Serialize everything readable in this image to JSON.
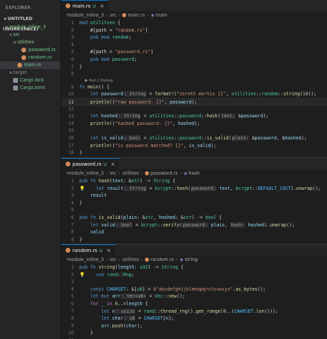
{
  "sidebar": {
    "title": "EXPLORER",
    "workspace": "UNTITLED (WORKSPACE)",
    "items": [
      {
        "label": "module_inline_3",
        "depth": 1,
        "chevron": "v",
        "kind": "folder",
        "color": "#89d185"
      },
      {
        "label": "src",
        "depth": 2,
        "chevron": "v",
        "kind": "folder",
        "color": "#89d185"
      },
      {
        "label": "utilities",
        "depth": 3,
        "chevron": "v",
        "kind": "folder",
        "color": "#89d185"
      },
      {
        "label": "password.rs",
        "depth": 4,
        "chevron": "",
        "kind": "rust",
        "color": "#73c991"
      },
      {
        "label": "random.rs",
        "depth": 4,
        "chevron": "",
        "kind": "rust",
        "color": "#73c991"
      },
      {
        "label": "main.rs",
        "depth": 3,
        "chevron": "",
        "kind": "rust",
        "color": "#73c991",
        "selected": true
      },
      {
        "label": "target",
        "depth": 2,
        "chevron": ">",
        "kind": "folder",
        "color": "#8c8c8c"
      },
      {
        "label": "Cargo.lock",
        "depth": 2,
        "chevron": "",
        "kind": "lock",
        "color": "#73c991"
      },
      {
        "label": "Cargo.toml",
        "depth": 2,
        "chevron": "",
        "kind": "toml",
        "color": "#73c991"
      }
    ]
  },
  "editors": [
    {
      "tab": {
        "label": "main.rs",
        "status": "U",
        "close": "×"
      },
      "breadcrumb": [
        "module_inline_3",
        "src",
        "main.rs",
        "main"
      ],
      "codelens": "▶ Run | Debug",
      "lines": [
        {
          "n": "1",
          "html": "<span class='k'>mod</span> <span class='t'>utilities</span> <span class='p'>{</span>"
        },
        {
          "n": "2",
          "html": "    <span class='p'>#[path = </span><span class='s'>\"random.rs\"</span><span class='p'>]</span>"
        },
        {
          "n": "3",
          "html": "    <span class='k'>pub</span> <span class='k'>mod</span> <span class='t'>random</span><span class='p'>;</span>"
        },
        {
          "n": "4",
          "html": ""
        },
        {
          "n": "5",
          "html": "    <span class='p'>#[path = </span><span class='s'>\"password.rs\"</span><span class='p'>]</span>"
        },
        {
          "n": "6",
          "html": "    <span class='k'>pub</span> <span class='k'>mod</span> <span class='t'>password</span><span class='p'>;</span>"
        },
        {
          "n": "7",
          "html": "<span class='p'>}</span>"
        },
        {
          "n": "8",
          "html": "",
          "lens": true
        },
        {
          "n": "9",
          "html": "<span class='k'>fn</span> <span class='f'>main</span><span class='p'>() {</span>"
        },
        {
          "n": "10",
          "html": "    <span class='k'>let</span> <span class='v'>password</span><span class='hint'>: String</span> <span class='p'>=</span> <span class='m'>format!</span><span class='p'>(</span><span class='s'>\"zereth mortis {}\"</span><span class='p'>, </span><span class='t'>utilities</span><span class='p'>::</span><span class='t'>random</span><span class='p'>::</span><span class='f'>string</span><span class='p'>(</span><span class='n'>10</span><span class='p'>));</span>"
        },
        {
          "n": "11",
          "html": "    <span class='m'>println!</span><span class='p'>(</span><span class='s'>\"raw password: {}\"</span><span class='p'>, </span><span class='v'>password</span><span class='p'>);</span>",
          "cur": true
        },
        {
          "n": "12",
          "html": ""
        },
        {
          "n": "13",
          "html": "    <span class='k'>let</span> <span class='v'>hashed</span><span class='hint'>: String</span> <span class='p'>=</span> <span class='t'>utilities</span><span class='p'>::</span><span class='t'>password</span><span class='p'>::</span><span class='f'>hash</span><span class='p'>(</span><span class='hint'>text:</span> <span class='p'>&amp;</span><span class='v'>password</span><span class='p'>);</span>"
        },
        {
          "n": "14",
          "html": "    <span class='m'>println!</span><span class='p'>(</span><span class='s'>\"hashed password: {}\"</span><span class='p'>, </span><span class='v'>hashed</span><span class='p'>);</span>"
        },
        {
          "n": "15",
          "html": ""
        },
        {
          "n": "16",
          "html": "    <span class='k'>let</span> <span class='v'>is_valid</span><span class='hint'>: bool</span> <span class='p'>=</span> <span class='t'>utilities</span><span class='p'>::</span><span class='t'>password</span><span class='p'>::</span><span class='f'>is_valid</span><span class='p'>(</span><span class='hint'>plain:</span> <span class='p'>&amp;</span><span class='v'>password</span><span class='p'>, &amp;</span><span class='v'>hashed</span><span class='p'>);</span>"
        },
        {
          "n": "17",
          "html": "    <span class='m'>println!</span><span class='p'>(</span><span class='s'>\"is password matched? {}\"</span><span class='p'>, </span><span class='v'>is_valid</span><span class='p'>);</span>"
        },
        {
          "n": "18",
          "html": "<span class='p'>}</span>"
        },
        {
          "n": "19",
          "html": ""
        }
      ]
    },
    {
      "tab": {
        "label": "password.rs",
        "status": "U",
        "close": "×"
      },
      "breadcrumb": [
        "module_inline_3",
        "src",
        "utilities",
        "password.rs",
        "hash"
      ],
      "lines": [
        {
          "n": "1",
          "html": "<span class='k'>pub</span> <span class='k'>fn</span> <span class='f'>hash</span><span class='p'>(</span><span class='v'>text</span><span class='p'>: &amp;</span><span class='t'>str</span><span class='p'>) -&gt; </span><span class='t'>String</span> <span class='p'>{</span>"
        },
        {
          "n": "2",
          "html": "    <span class='k'>let</span> <span class='v'>result</span><span class='hint'>: String</span> <span class='p'>=</span> <span class='t'>bcrypt</span><span class='p'>::</span><span class='f'>hash</span><span class='p'>(</span><span class='hint'>password:</span> <span class='v'>text</span><span class='p'>, </span><span class='t'>bcrypt</span><span class='p'>::</span><span class='c'>DEFAULT_COST</span><span class='p'>).</span><span class='f'>unwrap</span><span class='p'>();</span>",
          "bulb": true
        },
        {
          "n": "3",
          "html": "    <span class='v'>result</span>"
        },
        {
          "n": "4",
          "html": "<span class='p'>}</span>"
        },
        {
          "n": "5",
          "html": ""
        },
        {
          "n": "6",
          "html": "<span class='k'>pub</span> <span class='k'>fn</span> <span class='f'>is_valid</span><span class='p'>(</span><span class='v'>plain</span><span class='p'>: &amp;</span><span class='t'>str</span><span class='p'>, </span><span class='v'>hashed</span><span class='p'>: &amp;</span><span class='t'>str</span><span class='p'>) -&gt; </span><span class='t'>bool</span> <span class='p'>{</span>"
        },
        {
          "n": "7",
          "html": "    <span class='k'>let</span> <span class='v'>valid</span><span class='hint'>: bool</span> <span class='p'>=</span> <span class='t'>bcrypt</span><span class='p'>::</span><span class='f'>verify</span><span class='p'>(</span><span class='hint'>password:</span> <span class='v'>plain</span><span class='p'>, </span><span class='hint'>hash:</span> <span class='v'>hashed</span><span class='p'>).</span><span class='f'>unwrap</span><span class='p'>();</span>"
        },
        {
          "n": "8",
          "html": "    <span class='v'>valid</span>"
        },
        {
          "n": "9",
          "html": "<span class='p'>}</span>"
        },
        {
          "n": "10",
          "html": ""
        }
      ]
    },
    {
      "tab": {
        "label": "random.rs",
        "status": "U",
        "close": "×"
      },
      "breadcrumb": [
        "module_inline_3",
        "src",
        "utilities",
        "random.rs",
        "string"
      ],
      "lines": [
        {
          "n": "1",
          "html": "<span class='k'>pub</span> <span class='k'>fn</span> <span class='f'>string</span><span class='p'>(</span><span class='v'>length</span><span class='p'>: </span><span class='t'>u32</span><span class='p'>) -&gt; </span><span class='t'>String</span> <span class='p'>{</span>"
        },
        {
          "n": "2",
          "html": "    <span class='k'>use</span> <span class='t'>rand</span><span class='p'>::</span><span class='t'>Rng</span><span class='p'>;</span>",
          "bulb": true
        },
        {
          "n": "3",
          "html": ""
        },
        {
          "n": "4",
          "html": "    <span class='k'>const</span> <span class='c'>CHARSET</span><span class='p'>: &amp;[</span><span class='t'>u8</span><span class='p'>] = </span><span class='s'>b\"abcdefghijklmnopqrstuvwxyz\"</span><span class='p'>.</span><span class='f'>as_bytes</span><span class='p'>();</span>"
        },
        {
          "n": "5",
          "html": "    <span class='k'>let</span> <span class='k'>mut</span> <span class='v'>arr</span><span class='hint'>: Vec&lt;u8&gt;</span> <span class='p'>= </span><span class='t'>Vec</span><span class='p'>::</span><span class='f'>new</span><span class='p'>();</span>"
        },
        {
          "n": "6",
          "html": "    <span class='kc'>for</span> <span class='v'>_</span> <span class='kc'>in</span> <span class='n'>0</span><span class='p'>..=</span><span class='v'>length</span> <span class='p'>{</span>"
        },
        {
          "n": "7",
          "html": "        <span class='k'>let</span> <span class='v'>n</span><span class='hint'>: usize</span> <span class='p'>= </span><span class='t'>rand</span><span class='p'>::</span><span class='f'>thread_rng</span><span class='p'>().</span><span class='f'>gen_range</span><span class='p'>(</span><span class='n'>0</span><span class='p'>..(</span><span class='c'>CHARSET</span><span class='p'>.</span><span class='f'>len</span><span class='p'>()));</span>"
        },
        {
          "n": "8",
          "html": "        <span class='k'>let</span> <span class='v'>char</span><span class='hint'>: u8</span> <span class='p'>= </span><span class='c'>CHARSET</span><span class='p'>[</span><span class='v'>n</span><span class='p'>];</span>"
        },
        {
          "n": "9",
          "html": "        <span class='v'>arr</span><span class='p'>.</span><span class='f'>push</span><span class='p'>(</span><span class='v'>char</span><span class='p'>);</span>"
        },
        {
          "n": "10",
          "html": "    <span class='p'>}</span>"
        },
        {
          "n": "11",
          "html": ""
        }
      ]
    }
  ]
}
